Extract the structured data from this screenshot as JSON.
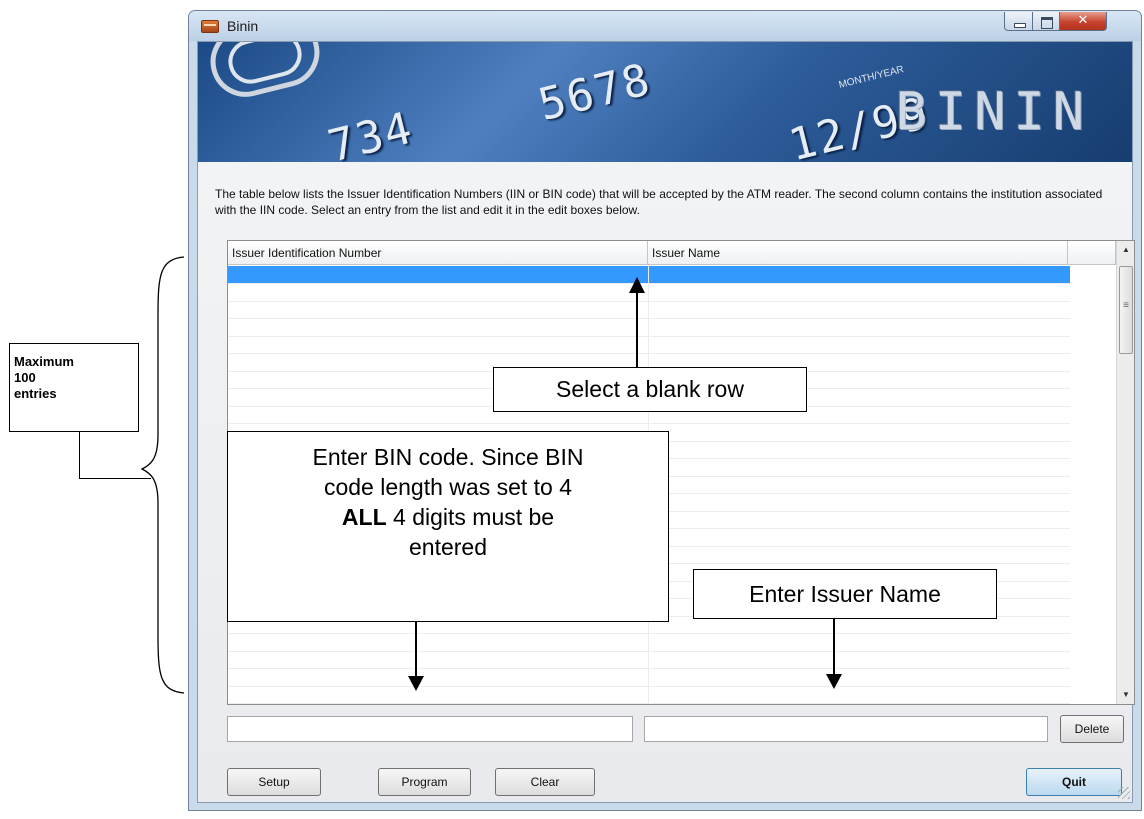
{
  "window": {
    "title": "Binin",
    "brand": "BININ",
    "card_numbers": [
      "734",
      "5678",
      "12/99"
    ],
    "card_label": "MONTH/YEAR"
  },
  "description": "The table below lists the Issuer Identification Numbers (IIN or BIN code) that will be accepted by the ATM reader. The second column contains the institution associated with the IIN code. Select an entry from the list and edit it in the edit boxes below.",
  "table": {
    "columns": [
      "Issuer Identification Number",
      "Issuer Name"
    ],
    "selected_row": 0,
    "row_count": 25
  },
  "inputs": {
    "bin_code": "",
    "issuer_name": ""
  },
  "buttons": {
    "delete": "Delete",
    "setup": "Setup",
    "program": "Program",
    "clear": "Clear",
    "quit": "Quit"
  },
  "annotations": {
    "select_row": "Select a blank row",
    "bin_line1": "Enter BIN code. Since BIN",
    "bin_line2": "code length was set to 4",
    "bin_bold": "ALL",
    "bin_line3_rest": " 4 digits must be",
    "bin_line4": "entered",
    "issuer_name": "Enter Issuer Name",
    "max_line1": "Maximum",
    "max_line2": "100",
    "max_line3": "entries"
  },
  "colors": {
    "selection": "#3399ff",
    "banner": "#2d5c99"
  }
}
